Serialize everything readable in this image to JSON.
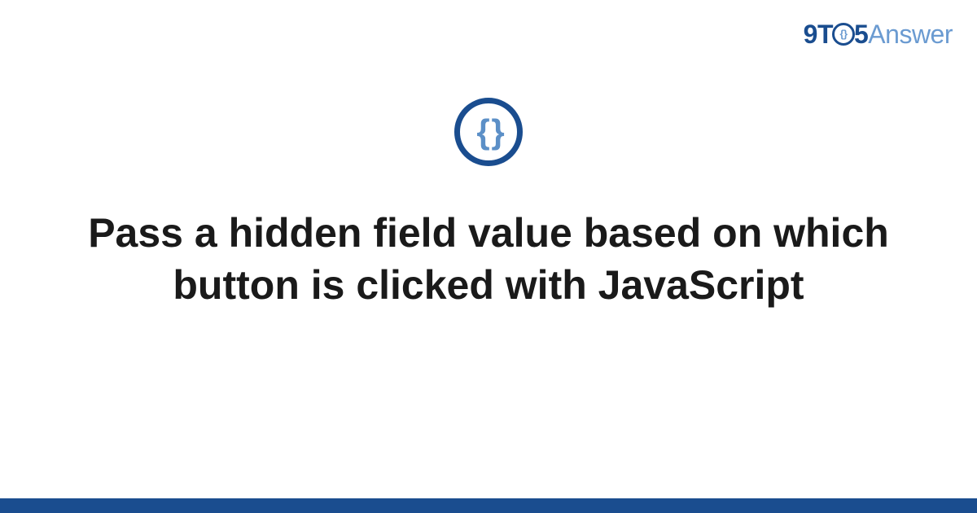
{
  "logo": {
    "part1": "9T",
    "circle_inner": "{}",
    "part2": "5",
    "part3": "Answer"
  },
  "icon": {
    "braces": "{ }"
  },
  "title": "Pass a hidden field value based on which button is clicked with JavaScript",
  "colors": {
    "primary": "#1a4d8f",
    "secondary": "#6b9bd1",
    "text": "#1a1a1a"
  }
}
